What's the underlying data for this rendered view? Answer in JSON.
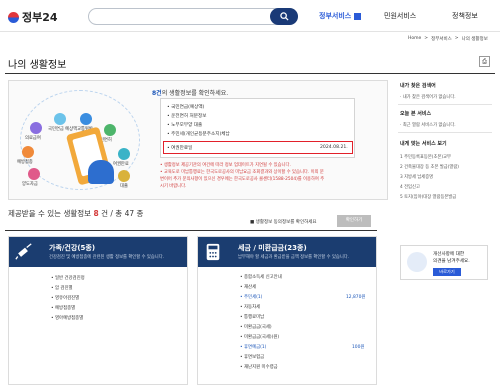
{
  "header": {
    "logo": "정부24",
    "search_placeholder": "",
    "nav": [
      "정부서비스",
      "민원서비스",
      "정책정보"
    ]
  },
  "breadcrumb": [
    "Home",
    ">",
    "정부서비스",
    ">",
    "나의 생활정보"
  ],
  "page_title": "나의 생활정보",
  "intro": {
    "head_count": "8건",
    "head_text": "의 생활정보를 확인하세요.",
    "ring_labels": [
      "국민연금 예상액",
      "교통위반",
      "운전면허",
      "의료급여",
      "예방접종",
      "여권만료",
      "대출",
      "양도자금",
      "교통위반"
    ],
    "list": [
      "• 국민연금(예상액)",
      "• 운전면허 처분정보",
      "• 노부모부양 대출",
      "• 주민세(개인균등분주소지)체납"
    ],
    "highlight_item": "• 여권만료일",
    "highlight_date": "2024.08.21.",
    "notes": [
      "• 생활정보 제공기관의 여건에 따라 정보 업데이트가 지연될 수 있습니다.",
      "• 교육도로 미납통행료는 한국도로공사의 미납요금 조회결과와 상이할 수 있습니다. 이외 문",
      "  변이어 추가 문의사항이 있으신 경우에는 한국도로공사 콜센터(1588-2504)를 이용하여 주",
      "  시기 바랍니다."
    ]
  },
  "count_row": {
    "prefix": "제공받을 수 있는 생활정보",
    "count": "8",
    "mid": "건 / 총",
    "total": "47",
    "suffix": "종",
    "link_text": "■ 생활정보 동의정보를 확인하세요",
    "link_btn": "확인하기"
  },
  "cards": [
    {
      "title": "가족/건강(5종)",
      "desc": "건강검진 및 예방접종에 관련된 생활 정보를 확인할 수 있습니다.",
      "items": [
        "• 일반 건강검진정",
        "• 암 검진별",
        "• 영유아검진별",
        "• 예방접종별",
        "• 영아예방접종별"
      ],
      "values": []
    },
    {
      "title": "세금 / 미환급금(23종)",
      "desc": "납부해야 할 세금과 환급받을 금액 정보를 확인할 수 있습니다.",
      "items": [
        "• 종합소득세 신고안내",
        "• 재산세",
        "• 주민세(1)",
        "• 자동차세",
        "• 통행료미납",
        "• 미환급금(국세)",
        "• 미환급금(국세)(원)",
        "• 휴면예금(1)",
        "• 휴면보험금",
        "• 재난지원 미수령금"
      ],
      "values": [
        "12,870원",
        "",
        "",
        "",
        "",
        "100원"
      ]
    }
  ],
  "sidebar": {
    "sections": [
      {
        "head": "내가 찾은 검색어",
        "text": "· 내가 찾은 검색어가 없습니다."
      },
      {
        "head": "오늘 본 서비스",
        "text": "· 최근 열람 서비스가 없습니다."
      },
      {
        "head": "내게 맞는 서비스 보기",
        "list": [
          "1  주민등록표등본(초본)교부",
          "2  건축물대장 등 초본 발급(열람)",
          "3  지방세 납세증명",
          "4  전입신고",
          "5  토지(임야)대장 열람등본발급"
        ]
      }
    ],
    "banner": {
      "line1": "개선사항에 대한",
      "line2": "의견을 남겨주세요.",
      "btn": "바로가기"
    }
  }
}
